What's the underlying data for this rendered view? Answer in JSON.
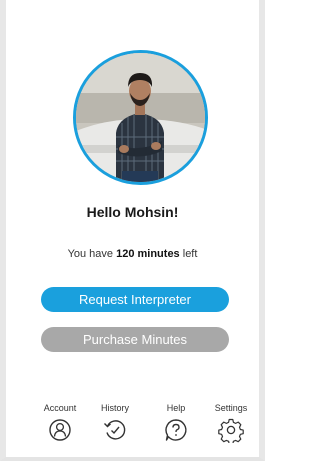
{
  "profile": {
    "greeting": "Hello Mohsin!",
    "minutes_prefix": "You have ",
    "minutes_value": "120 minutes",
    "minutes_suffix": " left"
  },
  "actions": {
    "request_label": "Request Interpreter",
    "purchase_label": "Purchase Minutes"
  },
  "nav": {
    "items": [
      {
        "label": "Account",
        "icon": "user-icon"
      },
      {
        "label": "History",
        "icon": "history-icon"
      },
      {
        "label": "Help",
        "icon": "help-icon"
      },
      {
        "label": "Settings",
        "icon": "gear-icon"
      }
    ]
  },
  "colors": {
    "accent": "#1aa0dd",
    "disabled": "#a8a8a8",
    "text": "#1a1a1a"
  }
}
